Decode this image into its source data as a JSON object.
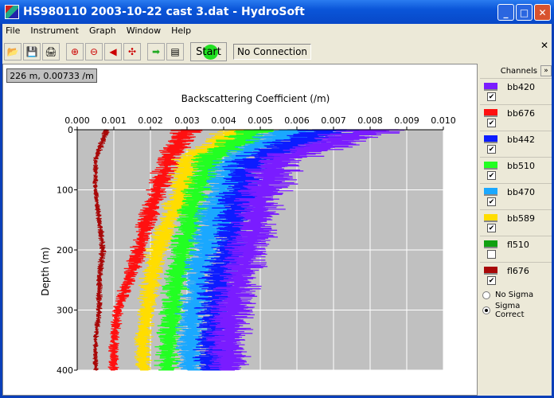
{
  "window": {
    "title": "HS980110 2003-10-22 cast 3.dat - HydroSoft",
    "minimize": "_",
    "maximize": "□",
    "close": "✕"
  },
  "menu": [
    "File",
    "Instrument",
    "Graph",
    "Window",
    "Help"
  ],
  "toolbar": {
    "icons": [
      "open-folder",
      "save-disk",
      "print",
      "zoom-in",
      "zoom-out",
      "zoom-back",
      "zoom-fit",
      "connect-arrow",
      "instrument-computer"
    ],
    "glyphs": [
      "📂",
      "💾",
      "🖨",
      "⊕",
      "⊖",
      "◀",
      "✣",
      "➡",
      "▤"
    ],
    "start_label": "Start",
    "connection_status": "No Connection"
  },
  "readout": "226 m, 0.00733 /m",
  "channels_panel": {
    "title": "Channels",
    "expand": "»",
    "channels": [
      {
        "name": "bb420",
        "color": "#7a1cff",
        "checked": true
      },
      {
        "name": "bb676",
        "color": "#ff1010",
        "checked": true
      },
      {
        "name": "bb442",
        "color": "#0c1cff",
        "checked": true
      },
      {
        "name": "bb510",
        "color": "#22ff22",
        "checked": true
      },
      {
        "name": "bb470",
        "color": "#1aa8ff",
        "checked": true
      },
      {
        "name": "bb589",
        "color": "#ffdd00",
        "checked": true
      },
      {
        "name": "fl510",
        "color": "#10a010",
        "checked": false
      },
      {
        "name": "fl676",
        "color": "#a80808",
        "checked": true
      }
    ],
    "sigma_options": [
      {
        "label": "No Sigma",
        "selected": false
      },
      {
        "label": "Sigma Correct",
        "selected": true
      }
    ]
  },
  "chart_data": {
    "type": "line",
    "title": "",
    "xlabel": "Backscattering Coefficient (/m)",
    "ylabel": "Depth (m)",
    "xlim": [
      0,
      0.01
    ],
    "ylim": [
      400,
      0
    ],
    "x_axis_position": "top",
    "y_inverted": true,
    "grid": true,
    "background": "#c0c0c0",
    "xticks": [
      "0.000",
      "0.001",
      "0.002",
      "0.003",
      "0.004",
      "0.005",
      "0.006",
      "0.007",
      "0.008",
      "0.009",
      "0.010"
    ],
    "yticks": [
      "0",
      "100",
      "200",
      "300",
      "400"
    ],
    "depth": [
      0,
      50,
      100,
      150,
      200,
      250,
      300,
      350,
      400
    ],
    "series": [
      {
        "name": "fl676",
        "color": "#a80808",
        "values": [
          0.0008,
          0.0005,
          0.0005,
          0.0006,
          0.0007,
          0.0006,
          0.0006,
          0.0005,
          0.0005
        ]
      },
      {
        "name": "bb676",
        "color": "#ff1010",
        "values": [
          0.003,
          0.0025,
          0.0022,
          0.0019,
          0.0017,
          0.0014,
          0.0011,
          0.001,
          0.001
        ]
      },
      {
        "name": "bb589",
        "color": "#ffdd00",
        "values": [
          0.0045,
          0.003,
          0.0029,
          0.0025,
          0.0022,
          0.002,
          0.0019,
          0.0018,
          0.0018
        ]
      },
      {
        "name": "bb510",
        "color": "#22ff22",
        "values": [
          0.005,
          0.0036,
          0.0033,
          0.0031,
          0.0029,
          0.0027,
          0.0026,
          0.0025,
          0.0025
        ]
      },
      {
        "name": "bb470",
        "color": "#1aa8ff",
        "values": [
          0.006,
          0.0042,
          0.004,
          0.0037,
          0.0035,
          0.0033,
          0.0032,
          0.0031,
          0.0031
        ]
      },
      {
        "name": "bb442",
        "color": "#0c1cff",
        "values": [
          0.007,
          0.0048,
          0.0045,
          0.0043,
          0.0042,
          0.0039,
          0.0038,
          0.0037,
          0.0037
        ]
      },
      {
        "name": "bb420",
        "color": "#7a1cff",
        "values": [
          0.008,
          0.0055,
          0.0051,
          0.0049,
          0.0047,
          0.0044,
          0.0042,
          0.0041,
          0.0041
        ]
      }
    ]
  }
}
